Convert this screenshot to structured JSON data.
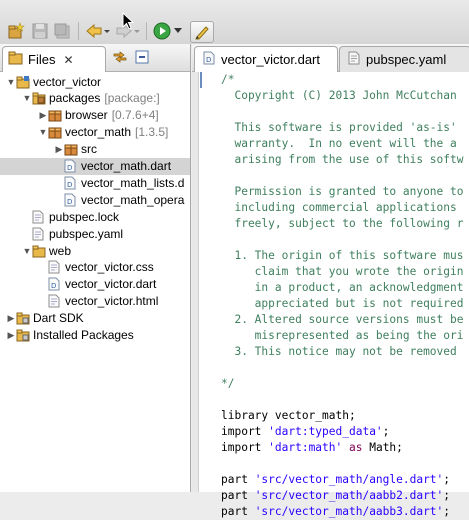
{
  "toolbar": {
    "icons": [
      "new-project-icon",
      "save-icon",
      "save-all-icon",
      "back-icon",
      "forward-icon",
      "run-icon",
      "run-dropdown-icon",
      "pen-icon"
    ]
  },
  "files_view": {
    "tab_label": "Files",
    "tab_close": "✕"
  },
  "tree": [
    {
      "label": "vector_victor",
      "meta": "",
      "icon": "project-folder",
      "depth": 0,
      "expanded": true,
      "twisty": "▼"
    },
    {
      "label": "packages",
      "meta": "[package:]",
      "icon": "package-folder",
      "depth": 1,
      "expanded": true,
      "twisty": "▼"
    },
    {
      "label": "browser",
      "meta": "[0.7.6+4]",
      "icon": "package",
      "depth": 2,
      "expanded": false,
      "twisty": "▶"
    },
    {
      "label": "vector_math",
      "meta": "[1.3.5]",
      "icon": "package",
      "depth": 2,
      "expanded": true,
      "twisty": "▼"
    },
    {
      "label": "src",
      "meta": "",
      "icon": "package",
      "depth": 3,
      "expanded": false,
      "twisty": "▶"
    },
    {
      "label": "vector_math.dart",
      "meta": "",
      "icon": "dart-file",
      "depth": 3,
      "selected": true,
      "twisty": ""
    },
    {
      "label": "vector_math_lists.d",
      "meta": "",
      "icon": "dart-file",
      "depth": 3,
      "twisty": ""
    },
    {
      "label": "vector_math_opera",
      "meta": "",
      "icon": "dart-file",
      "depth": 3,
      "twisty": ""
    },
    {
      "label": "pubspec.lock",
      "meta": "",
      "icon": "file",
      "depth": 1,
      "twisty": ""
    },
    {
      "label": "pubspec.yaml",
      "meta": "",
      "icon": "file",
      "depth": 1,
      "twisty": ""
    },
    {
      "label": "web",
      "meta": "",
      "icon": "folder",
      "depth": 1,
      "expanded": true,
      "twisty": "▼"
    },
    {
      "label": "vector_victor.css",
      "meta": "",
      "icon": "file",
      "depth": 2,
      "twisty": ""
    },
    {
      "label": "vector_victor.dart",
      "meta": "",
      "icon": "dart-file",
      "depth": 2,
      "twisty": ""
    },
    {
      "label": "vector_victor.html",
      "meta": "",
      "icon": "file",
      "depth": 2,
      "twisty": ""
    },
    {
      "label": "Dart SDK",
      "meta": "",
      "icon": "library",
      "depth": 0,
      "expanded": false,
      "twisty": "▶"
    },
    {
      "label": "Installed Packages",
      "meta": "",
      "icon": "library",
      "depth": 0,
      "expanded": false,
      "twisty": "▶"
    }
  ],
  "editor": {
    "tabs": [
      {
        "label": "vector_victor.dart",
        "active": true
      },
      {
        "label": "pubspec.yaml",
        "active": false
      }
    ],
    "lines": [
      [
        {
          "t": "/*",
          "c": "cm"
        }
      ],
      [
        {
          "t": "  Copyright (C) 2013 John McCutchan",
          "c": "cm"
        }
      ],
      [],
      [
        {
          "t": "  This software is provided 'as-is'",
          "c": "cm"
        }
      ],
      [
        {
          "t": "  warranty.  In no event will the a",
          "c": "cm"
        }
      ],
      [
        {
          "t": "  arising from the use of this softw",
          "c": "cm"
        }
      ],
      [],
      [
        {
          "t": "  Permission is granted to anyone to",
          "c": "cm"
        }
      ],
      [
        {
          "t": "  including commercial applications",
          "c": "cm"
        }
      ],
      [
        {
          "t": "  freely, subject to the following r",
          "c": "cm"
        }
      ],
      [],
      [
        {
          "t": "  1. The origin of this software mus",
          "c": "cm"
        }
      ],
      [
        {
          "t": "     claim that you wrote the origin",
          "c": "cm"
        }
      ],
      [
        {
          "t": "     in a product, an acknowledgment",
          "c": "cm"
        }
      ],
      [
        {
          "t": "     appreciated but is not required",
          "c": "cm"
        }
      ],
      [
        {
          "t": "  2. Altered source versions must be",
          "c": "cm"
        }
      ],
      [
        {
          "t": "     misrepresented as being the ori",
          "c": "cm"
        }
      ],
      [
        {
          "t": "  3. This notice may not be removed",
          "c": "cm"
        }
      ],
      [],
      [
        {
          "t": "*/",
          "c": "cm"
        }
      ],
      [],
      [
        {
          "t": "library vector_math;",
          "c": "pl"
        }
      ],
      [
        {
          "t": "import ",
          "c": "pl"
        },
        {
          "t": "'dart:typed_data'",
          "c": "str"
        },
        {
          "t": ";",
          "c": "pl"
        }
      ],
      [
        {
          "t": "import ",
          "c": "pl"
        },
        {
          "t": "'dart:math'",
          "c": "str"
        },
        {
          "t": " ",
          "c": "pl"
        },
        {
          "t": "as",
          "c": "kw"
        },
        {
          "t": " Math;",
          "c": "pl"
        }
      ],
      [],
      [
        {
          "t": "part ",
          "c": "pl"
        },
        {
          "t": "'src/vector_math/angle.dart'",
          "c": "str"
        },
        {
          "t": ";",
          "c": "pl"
        }
      ],
      [
        {
          "t": "part ",
          "c": "pl"
        },
        {
          "t": "'src/vector_math/aabb2.dart'",
          "c": "str"
        },
        {
          "t": ";",
          "c": "pl"
        }
      ],
      [
        {
          "t": "part ",
          "c": "pl"
        },
        {
          "t": "'src/vector_math/aabb3.dart'",
          "c": "str"
        },
        {
          "t": ";",
          "c": "pl"
        }
      ]
    ]
  }
}
